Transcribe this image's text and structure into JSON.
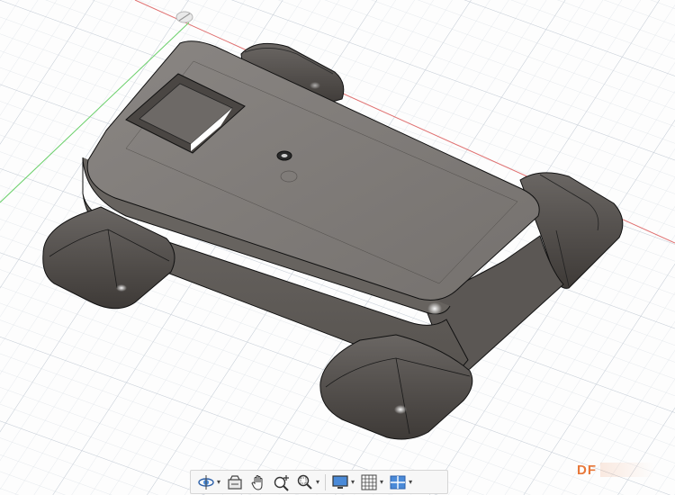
{
  "viewport": {
    "label": "",
    "axes": {
      "x_axis_color": "#e05050",
      "y_axis_color": "#40c040",
      "grid_color": "#cfd6df"
    },
    "model": {
      "body_color": "#6e6a67",
      "edge_color": "#1a1a1a"
    }
  },
  "toolbar": {
    "buttons": [
      {
        "id": "orbit",
        "icon": "orbit-icon",
        "has_dropdown": true
      },
      {
        "id": "look-at",
        "icon": "look-at-icon",
        "has_dropdown": false
      },
      {
        "id": "pan",
        "icon": "hand-pan-icon",
        "has_dropdown": false
      },
      {
        "id": "zoom",
        "icon": "zoom-icon",
        "has_dropdown": false
      },
      {
        "id": "fit",
        "icon": "zoom-window-icon",
        "has_dropdown": true
      },
      {
        "id": "display-settings",
        "icon": "display-settings-icon",
        "has_dropdown": true
      },
      {
        "id": "grid-snaps",
        "icon": "grid-icon",
        "has_dropdown": true
      },
      {
        "id": "viewports",
        "icon": "viewports-icon",
        "has_dropdown": true
      }
    ]
  },
  "watermark": {
    "text": "DF",
    "color": "#e8783a"
  }
}
